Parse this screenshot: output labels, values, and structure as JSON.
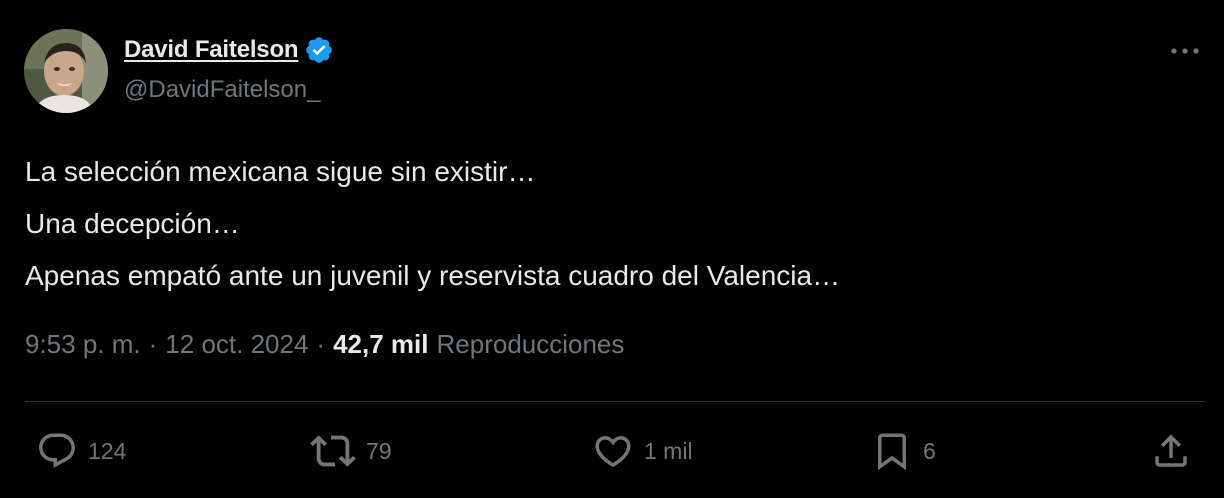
{
  "author": {
    "display_name": "David Faitelson",
    "handle": "@DavidFaitelson_",
    "verified_icon": "verified-badge-icon",
    "badge_color": "#1d9bf0"
  },
  "tweet": {
    "lines": [
      "La selección mexicana sigue sin existir…",
      "Una decepción…",
      "Apenas empató ante un juvenil y reservista cuadro del Valencia…"
    ],
    "time": "9:53 p. m.",
    "separator": "·",
    "date": "12 oct. 2024",
    "views_count": "42,7 mil",
    "views_label": "Reproducciones"
  },
  "actions": {
    "reply": {
      "icon": "reply-icon",
      "count": "124"
    },
    "retweet": {
      "icon": "retweet-icon",
      "count": "79"
    },
    "like": {
      "icon": "heart-icon",
      "count": "1 mil"
    },
    "bookmark": {
      "icon": "bookmark-icon",
      "count": "6"
    },
    "share": {
      "icon": "share-icon"
    }
  },
  "more": {
    "icon": "more-options-icon"
  },
  "colors": {
    "background": "#000000",
    "text_primary": "#e7e9ea",
    "text_secondary": "#71767b",
    "divider": "#2f3336"
  }
}
